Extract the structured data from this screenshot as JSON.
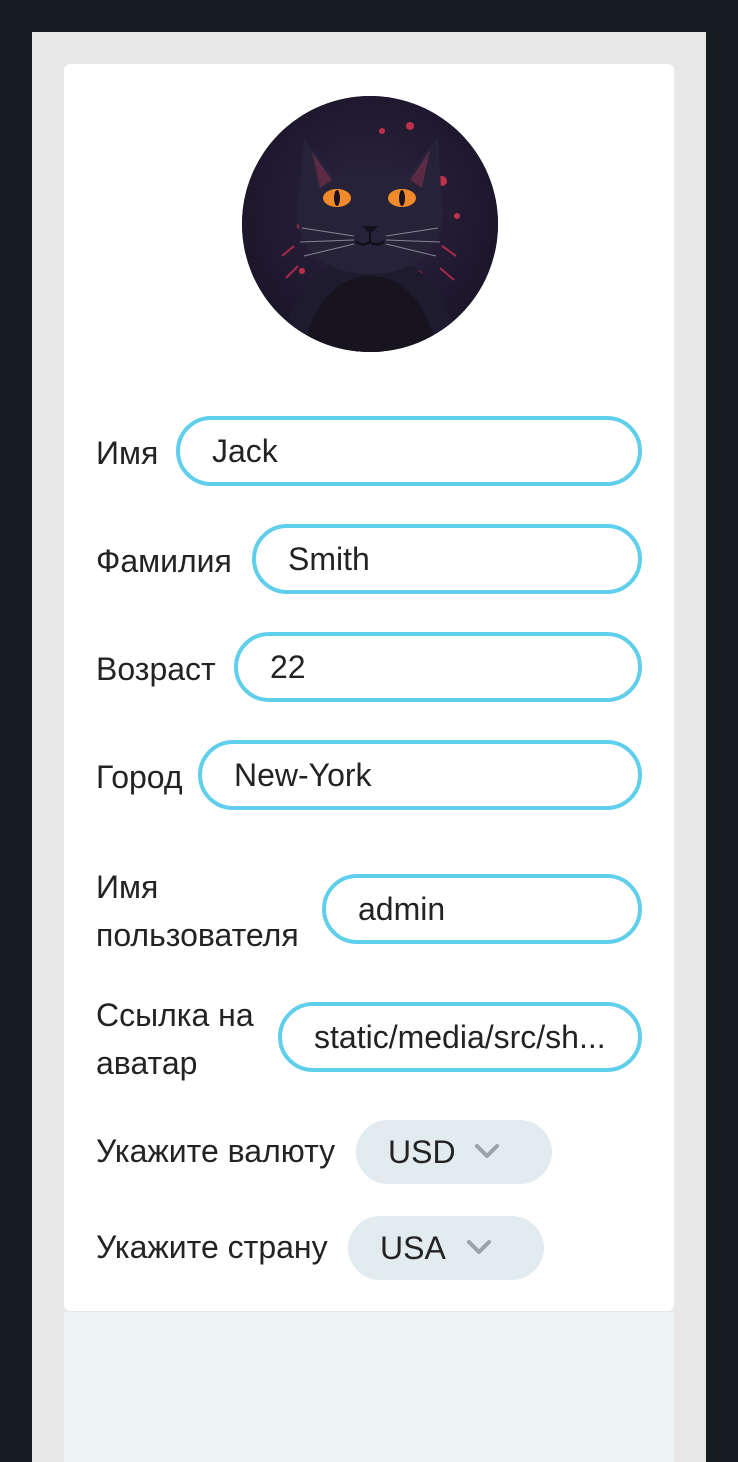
{
  "profile": {
    "avatar_alt": "",
    "fields": {
      "first_name": {
        "label": "Имя",
        "value": "Jack"
      },
      "last_name": {
        "label": "Фамилия",
        "value": "Smith"
      },
      "age": {
        "label": "Возраст",
        "value": "22"
      },
      "city": {
        "label": "Город",
        "value": "New-York"
      },
      "username": {
        "label": "Имя пользователя",
        "value": "admin"
      },
      "avatar_link": {
        "label": "Ссылка на аватар",
        "value": "static/media/src/sh..."
      }
    },
    "currency": {
      "label": "Укажите валюту",
      "value": "USD"
    },
    "country": {
      "label": "Укажите страну",
      "value": "USA"
    }
  },
  "colors": {
    "page_bg": "#161d20",
    "frame_bg": "#e8e8e9",
    "card_bg": "#ffffff",
    "input_border": "#5fcfec",
    "select_bg": "#e2ecef",
    "text": "#232323",
    "chevron": "#9aa4a8"
  },
  "icons": {
    "avatar": "cat-avatar-image",
    "currency_chevron": "chevron-down-icon",
    "country_chevron": "chevron-down-icon"
  }
}
